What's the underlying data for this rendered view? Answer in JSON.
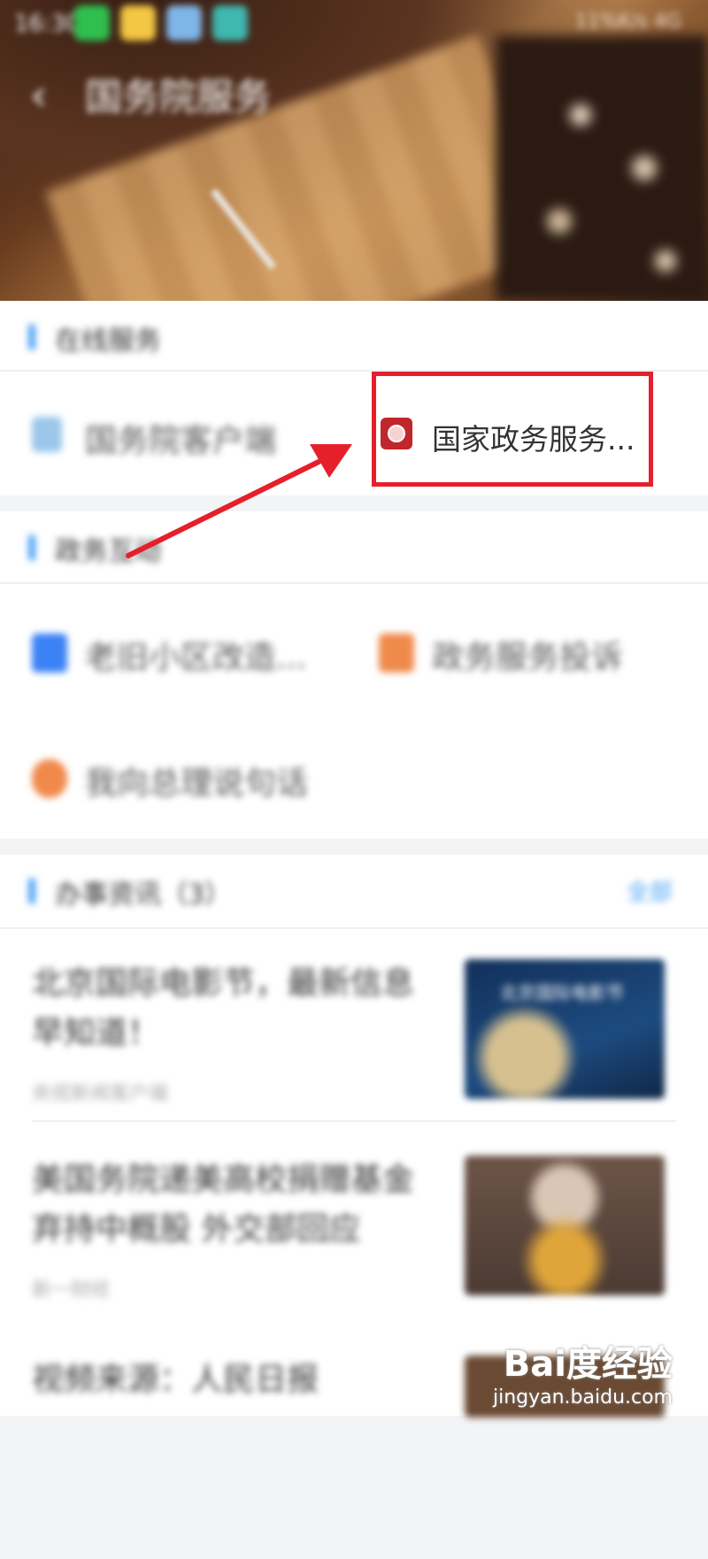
{
  "status_bar": {
    "time": "16:30",
    "right": "11%K/s  4G"
  },
  "header": {
    "back_icon": "chevron-left-icon",
    "title": "国务院服务"
  },
  "online_services": {
    "title": "在线服务",
    "items": [
      {
        "label": "国务院客户端",
        "icon": "app-icon",
        "color": "#8fc0e8"
      },
      {
        "label": "国家政务服务...",
        "icon": "national-emblem-icon",
        "color": "#c0272d"
      }
    ]
  },
  "interaction": {
    "title": "政务互动",
    "items": [
      {
        "label": "老旧小区改造...",
        "icon": "document-icon",
        "color": "#3b82f6"
      },
      {
        "label": "政务服务投诉",
        "icon": "document-icon",
        "color": "#f08a4b"
      },
      {
        "label": "我向总理说句话",
        "icon": "chat-icon",
        "color": "#f08a4b"
      }
    ]
  },
  "news": {
    "title": "办事资讯（3）",
    "more": "全部",
    "items": [
      {
        "title": "北京国际电影节，最新信息早知道！",
        "source": "央视新闻客户端"
      },
      {
        "title": "美国务院递美高校捐赠基金弃持中概股 外交部回应",
        "source": "新一财经"
      },
      {
        "title": "视频来源：人民日报",
        "source": ""
      }
    ],
    "thumb1_caption": "北京国际电影节"
  },
  "annotation": {
    "highlight_color": "#e5202b"
  },
  "watermark": {
    "logo": "Bai度经验",
    "url": "jingyan.baidu.com"
  }
}
